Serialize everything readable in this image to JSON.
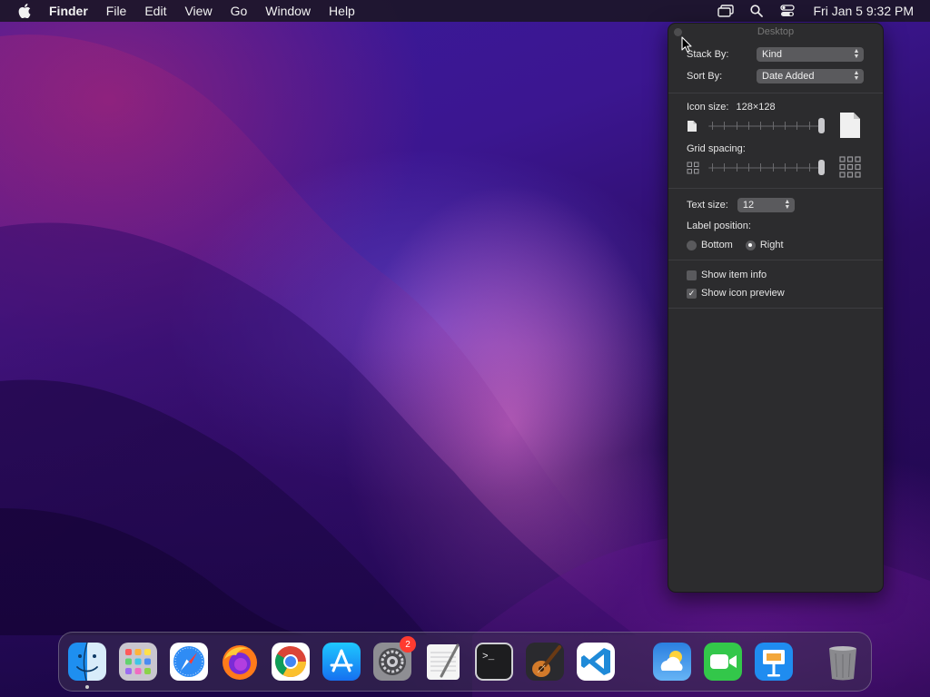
{
  "menubar": {
    "app_name": "Finder",
    "menus": [
      "File",
      "Edit",
      "View",
      "Go",
      "Window",
      "Help"
    ],
    "clock": "Fri Jan 5  9:32 PM",
    "icons": [
      "apple-icon",
      "screen-mirroring-icon",
      "spotlight-search-icon",
      "control-center-icon"
    ]
  },
  "panel": {
    "title": "Desktop",
    "stack_by_label": "Stack By:",
    "stack_by_value": "Kind",
    "sort_by_label": "Sort By:",
    "sort_by_value": "Date Added",
    "icon_size_label": "Icon size:",
    "icon_size_value": "128×128",
    "icon_size_level": 1.0,
    "grid_spacing_label": "Grid spacing:",
    "grid_spacing_level": 1.0,
    "text_size_label": "Text size:",
    "text_size_value": "12",
    "label_position_label": "Label position:",
    "label_position_options": [
      "Bottom",
      "Right"
    ],
    "label_position_selected": "Right",
    "show_item_info_label": "Show item info",
    "show_item_info_checked": false,
    "show_icon_preview_label": "Show icon preview",
    "show_icon_preview_checked": true
  },
  "dock": {
    "apps": [
      {
        "name": "finder-icon",
        "running": true
      },
      {
        "name": "launchpad-icon"
      },
      {
        "name": "safari-icon"
      },
      {
        "name": "firefox-icon"
      },
      {
        "name": "chrome-icon"
      },
      {
        "name": "app-store-icon"
      },
      {
        "name": "system-settings-icon",
        "badge": "2"
      },
      {
        "name": "textedit-icon"
      },
      {
        "name": "terminal-icon"
      },
      {
        "name": "garageband-icon"
      },
      {
        "name": "vscode-icon"
      },
      {
        "name": "weather-icon"
      },
      {
        "name": "facetime-icon"
      },
      {
        "name": "keynote-icon"
      },
      {
        "name": "trash-icon"
      }
    ],
    "terminal_prompt": ">_"
  },
  "colors": {
    "accent": "#0a84ff",
    "badge": "#ff3b30",
    "panel_bg": "#2c2c2e"
  }
}
